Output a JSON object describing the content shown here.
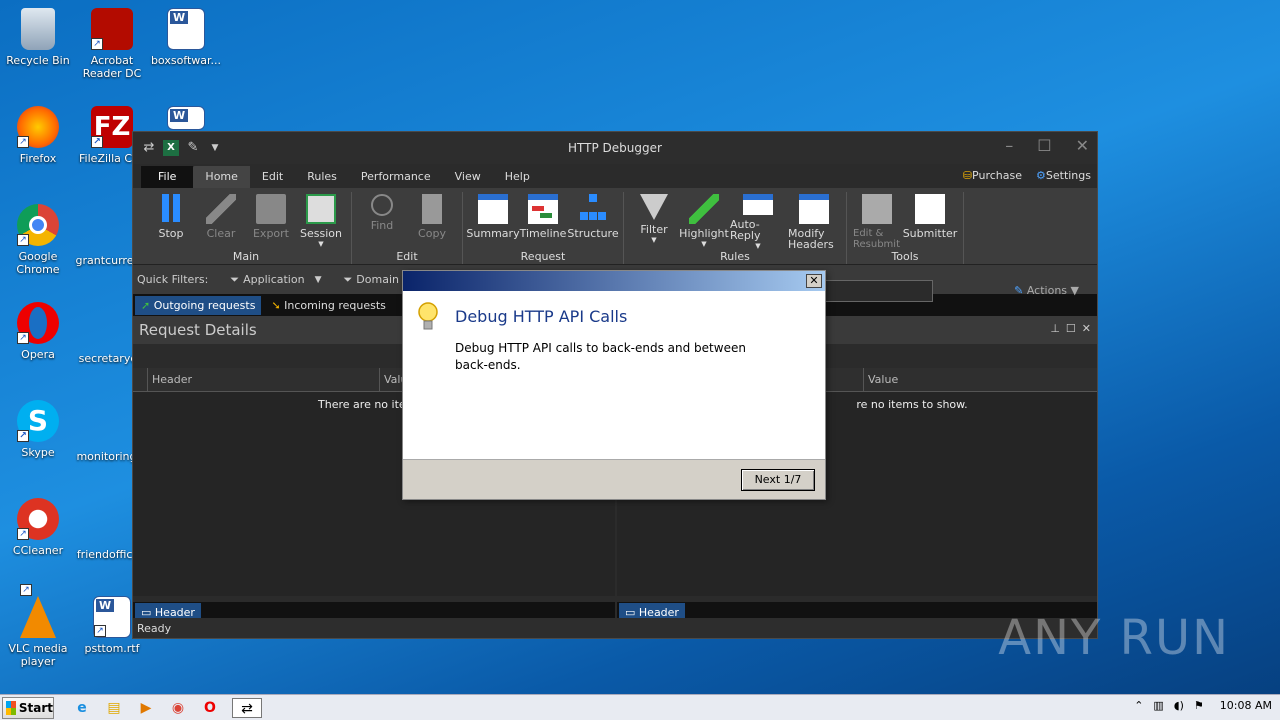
{
  "desktop": {
    "icons": [
      {
        "label": "Recycle Bin",
        "icon": "recycle-bin-icon"
      },
      {
        "label": "Acrobat Reader DC",
        "icon": "acrobat-icon"
      },
      {
        "label": "boxsoftwar...",
        "icon": "word-doc-icon"
      },
      {
        "label": "Firefox",
        "icon": "firefox-icon"
      },
      {
        "label": "FileZilla Clie",
        "icon": "filezilla-icon"
      },
      {
        "label": "Google Chrome",
        "icon": "chrome-icon"
      },
      {
        "label": "grantcurren",
        "icon": "word-doc-icon"
      },
      {
        "label": "Opera",
        "icon": "opera-icon"
      },
      {
        "label": "secretaryd",
        "icon": "word-doc-icon"
      },
      {
        "label": "Skype",
        "icon": "skype-icon"
      },
      {
        "label": "monitoringi",
        "icon": "word-doc-icon"
      },
      {
        "label": "CCleaner",
        "icon": "ccleaner-icon"
      },
      {
        "label": "friendoffice",
        "icon": "word-doc-icon"
      },
      {
        "label": "VLC media player",
        "icon": "vlc-icon"
      },
      {
        "label": "psttom.rtf",
        "icon": "word-doc-icon"
      }
    ]
  },
  "window": {
    "title": "HTTP Debugger",
    "menu": {
      "file": "File",
      "tabs": [
        "Home",
        "Edit",
        "Rules",
        "Performance",
        "View",
        "Help"
      ],
      "purchase": "Purchase",
      "settings": "Settings"
    },
    "ribbon": {
      "main": {
        "label": "Main",
        "buttons": [
          "Stop",
          "Clear",
          "Export",
          "Session"
        ]
      },
      "edit": {
        "label": "Edit",
        "buttons": [
          "Find",
          "Copy"
        ]
      },
      "request": {
        "label": "Request",
        "buttons": [
          "Summary",
          "Timeline",
          "Structure"
        ]
      },
      "rules": {
        "label": "Rules",
        "buttons": [
          "Filter",
          "Highlight",
          "Auto-Reply",
          "Modify Headers"
        ]
      },
      "tools": {
        "label": "Tools",
        "buttons": [
          "Edit & Resubmit",
          "Submitter"
        ]
      }
    },
    "filters": {
      "label": "Quick Filters:",
      "application": "Application",
      "domain": "Domain",
      "actions": "Actions"
    },
    "tabs": {
      "outgoing": "Outgoing requests",
      "incoming": "Incoming requests"
    },
    "details": {
      "title": "Request Details",
      "left": {
        "col1": "Header",
        "col2": "Valu",
        "empty": "There are no items t",
        "footer_tab": "Header"
      },
      "right": {
        "col2": "Value",
        "empty": "re no items to show.",
        "footer_tab": "Header"
      }
    },
    "status": "Ready"
  },
  "dialog": {
    "title": "Debug HTTP API Calls",
    "text": "Debug HTTP API calls to back-ends and between back-ends.",
    "next": "Next 1/7",
    "close": "✕"
  },
  "taskbar": {
    "start": "Start",
    "time": "10:08 AM"
  },
  "watermark": "ANY RUN"
}
